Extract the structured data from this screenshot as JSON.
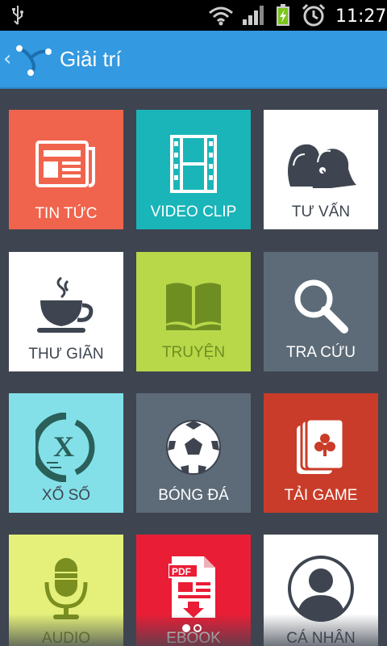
{
  "status_bar": {
    "time": "11:27",
    "icons": [
      "usb-icon",
      "wifi-icon",
      "signal-icon",
      "battery-charging-icon",
      "alarm-clock-icon"
    ]
  },
  "header": {
    "back_glyph": "‹",
    "title": "Giải trí",
    "accent_color": "#3399e0"
  },
  "tiles": [
    {
      "label": "TIN TỨC",
      "icon": "newspaper-icon",
      "color": "#f0644d"
    },
    {
      "label": "VIDEO CLIP",
      "icon": "film-strip-icon",
      "color": "#19b5b9"
    },
    {
      "label": "TƯ VẤN",
      "icon": "support-agents-icon",
      "color": "#ffffff"
    },
    {
      "label": "THƯ GIÃN",
      "icon": "coffee-cup-icon",
      "color": "#ffffff"
    },
    {
      "label": "TRUYỆN",
      "icon": "open-book-icon",
      "color": "#b8d849"
    },
    {
      "label": "TRA CỨU",
      "icon": "magnifier-icon",
      "color": "#5d6b78"
    },
    {
      "label": "XỔ SỐ",
      "icon": "lottery-x-icon",
      "color": "#84e0e8"
    },
    {
      "label": "BÓNG ĐÁ",
      "icon": "soccer-ball-icon",
      "color": "#5d6b78"
    },
    {
      "label": "TẢI GAME",
      "icon": "playing-cards-icon",
      "color": "#c93c29"
    },
    {
      "label": "AUDIO",
      "icon": "microphone-icon",
      "color": "#e4f07a"
    },
    {
      "label": "EBOOK",
      "icon": "pdf-download-icon",
      "color": "#ea1d36"
    },
    {
      "label": "CÁ NHÂN",
      "icon": "user-profile-icon",
      "color": "#ffffff"
    }
  ],
  "pager": {
    "pages": 2,
    "current": 1
  }
}
